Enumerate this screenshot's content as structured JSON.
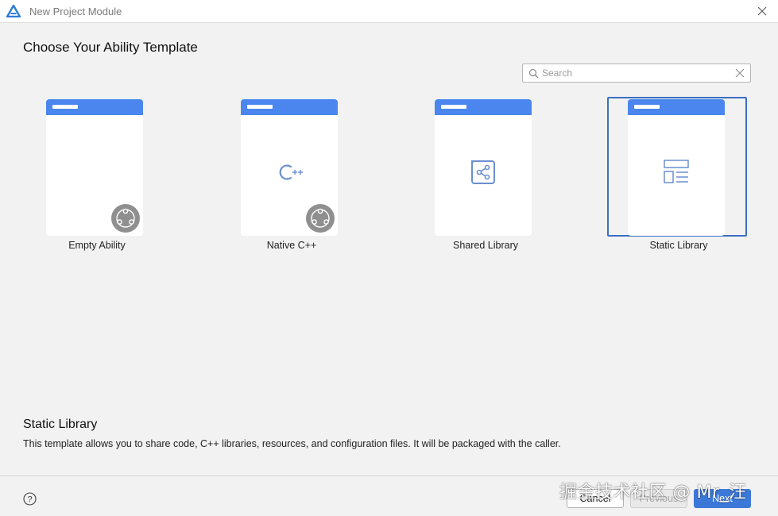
{
  "window": {
    "title": "New Project Module"
  },
  "heading": "Choose Your Ability Template",
  "search": {
    "placeholder": "Search",
    "value": ""
  },
  "templates": [
    {
      "label": "Empty Ability",
      "icon": "blank-icon",
      "badge": "hmos-badge-icon",
      "selected": false
    },
    {
      "label": "Native C++",
      "icon": "cpp-icon",
      "badge": "hmos-badge-icon",
      "selected": false
    },
    {
      "label": "Shared Library",
      "icon": "share-icon",
      "badge": "",
      "selected": false
    },
    {
      "label": "Static Library",
      "icon": "layout-list-icon",
      "badge": "",
      "selected": true
    }
  ],
  "description": {
    "title": "Static Library",
    "text": "This template allows you to share code, C++ libraries, resources, and configuration files. It will be packaged with the caller."
  },
  "buttons": {
    "cancel": "Cancel",
    "previous": "Previous",
    "next": "Next"
  },
  "watermark": "掘金技术社区 @ Mr_汪",
  "colors": {
    "accent": "#3c78d8",
    "card_header": "#4a86ee",
    "badge": "#8f8f8f",
    "selection": "#3a6fc4"
  }
}
